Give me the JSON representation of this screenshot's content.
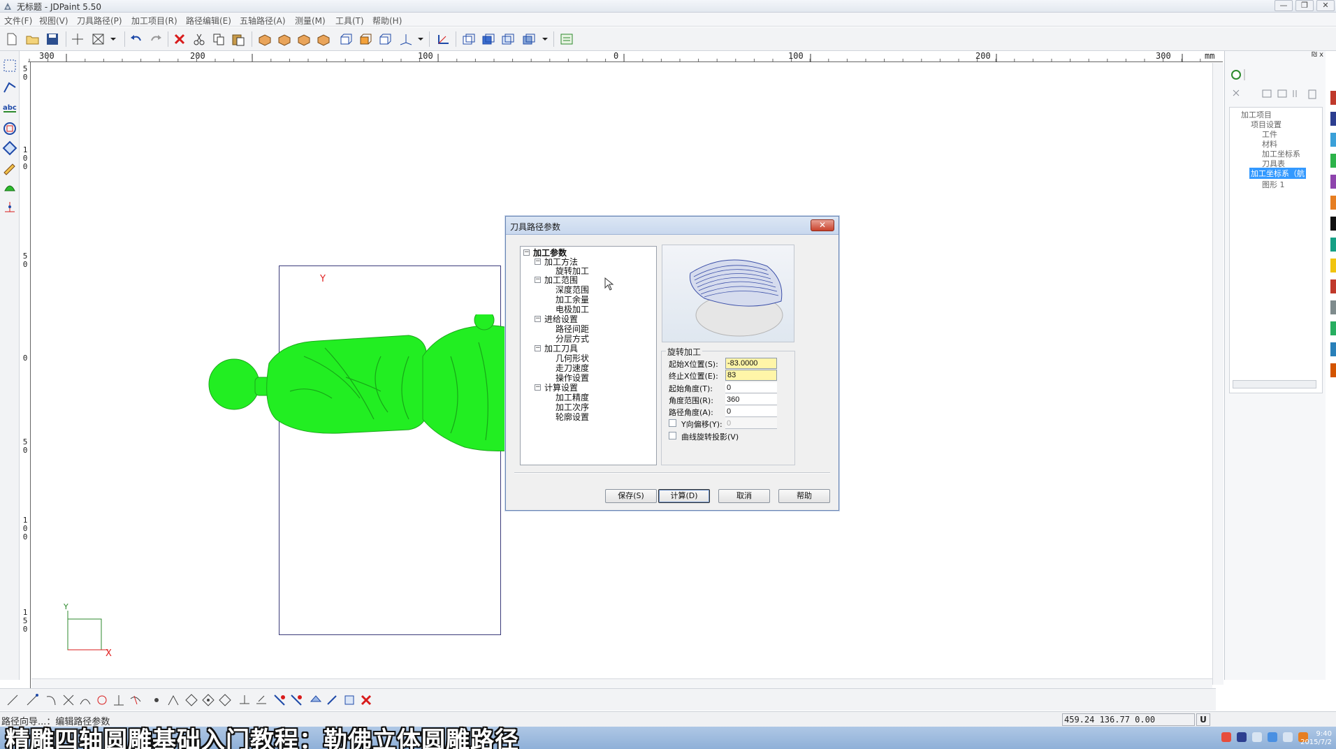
{
  "window": {
    "title": "无标题 - JDPaint 5.50",
    "min": "—",
    "restore": "❐",
    "close": "✕"
  },
  "menu": [
    "文件(F)",
    "视图(V)",
    "刀具路径(P)",
    "加工项目(R)",
    "路径编辑(E)",
    "五轴路径(A)",
    "测量(M)",
    "工具(T)",
    "帮助(H)"
  ],
  "ruler": {
    "labels": [
      "300",
      "200",
      "100",
      "0",
      "100",
      "200",
      "300"
    ],
    "unit": "mm",
    "vlabels": [
      "5\n0",
      "1\n0\n0",
      "5\n0",
      "0",
      "5\n0",
      "1\n0\n0",
      "1\n5\n0"
    ]
  },
  "canvas": {
    "y_marker": "Y",
    "x_axis": "X",
    "y_axis": "Y"
  },
  "right_panel": {
    "header": "₪ x",
    "tree": [
      {
        "label": "加工项目"
      },
      {
        "label": "项目设置"
      },
      {
        "label": "工件"
      },
      {
        "label": "材料"
      },
      {
        "label": "加工坐标系"
      },
      {
        "label": "刀具表"
      },
      {
        "label": "加工坐标系（航"
      },
      {
        "label": "图形 1"
      }
    ]
  },
  "dialog": {
    "title": "刀具路径参数",
    "close": "✕",
    "tree": {
      "root": "加工参数",
      "method": "加工方法",
      "method_item": "旋转加工",
      "range": "加工范围",
      "range_items": [
        "深度范围",
        "加工余量",
        "电极加工"
      ],
      "feed": "进给设置",
      "feed_items": [
        "路径间距",
        "分层方式"
      ],
      "tool": "加工刀具",
      "tool_items": [
        "几何形状",
        "走刀速度",
        "操作设置"
      ],
      "calc": "计算设置",
      "calc_items": [
        "加工精度",
        "加工次序",
        "轮廓设置"
      ]
    },
    "group_title": "旋转加工",
    "fields": [
      {
        "label": "起始X位置(S):",
        "value": "-83.0000"
      },
      {
        "label": "终止X位置(E):",
        "value": "83"
      },
      {
        "label": "起始角度(T):",
        "value": "0"
      },
      {
        "label": "角度范围(R):",
        "value": "360"
      },
      {
        "label": "路径角度(A):",
        "value": "0"
      }
    ],
    "check_offset": {
      "label": "Y向偏移(Y):",
      "value": "0"
    },
    "check_project": {
      "label": "曲线旋转投影(V)"
    },
    "buttons": {
      "save": "保存(S)",
      "calc": "计算(D)",
      "cancel": "取消",
      "help": "帮助"
    }
  },
  "status": {
    "left": "路径向导...：编辑路径参数",
    "coords": "459.24 136.77 0.00",
    "mode": "U"
  },
  "caption": "精雕四轴圆雕基础入门教程：勒佛立体圆雕路径",
  "clock": {
    "time": "9:40",
    "date": "2015/7/2"
  },
  "colors": {
    "model": "#22ee22",
    "accent": "#3399ff",
    "highlight": "#fff5a8"
  }
}
